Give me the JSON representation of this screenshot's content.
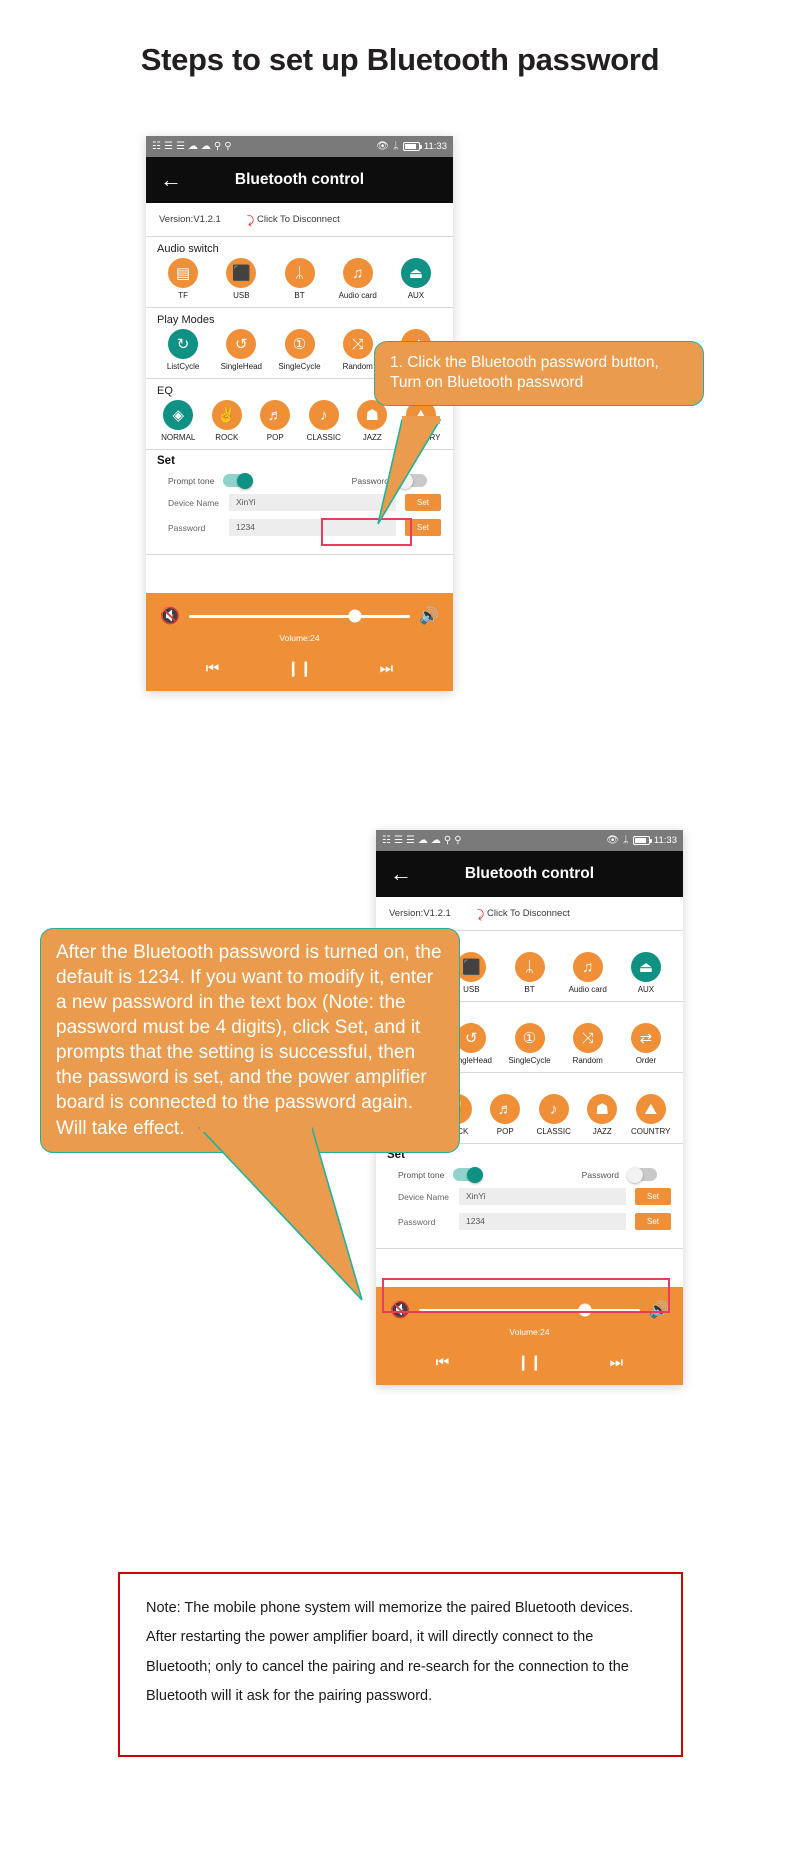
{
  "page": {
    "title": "Steps to set up Bluetooth password"
  },
  "colors": {
    "accent_orange": "#ef9039",
    "active_teal": "#0f9183",
    "callout_bg": "#eb9b4e",
    "callout_border": "#1fb39b",
    "highlight_red": "#ec3b5e",
    "note_border": "#cc0000",
    "appbar_black": "#0d0d0d",
    "statusbar_gray": "#7a7a7a"
  },
  "phone": {
    "statusbar": {
      "time": "11:33",
      "left_icons": [
        "sim-dual-icon",
        "signal-1-icon",
        "signal-2-icon",
        "wifi-icon",
        "cloud-icon",
        "person-1-icon",
        "person-2-icon"
      ],
      "right_icons": [
        "eye-icon",
        "bluetooth-icon",
        "battery-icon"
      ]
    },
    "appbar": {
      "back_label": "←",
      "title": "Bluetooth control"
    },
    "version_row": {
      "version": "Version:V1.2.1",
      "disconnect_label": "Click To Disconnect",
      "disconnect_icon": "broken-link-icon"
    },
    "audio_switch": {
      "heading": "Audio switch",
      "items": [
        {
          "label": "TF",
          "icon": "sd-card-icon",
          "glyph": "▤",
          "active": false
        },
        {
          "label": "USB",
          "icon": "usb-drive-icon",
          "glyph": "⬛",
          "active": false
        },
        {
          "label": "BT",
          "icon": "bluetooth-icon",
          "glyph": "ᛦ",
          "active": false
        },
        {
          "label": "Audio card",
          "icon": "music-note-icon",
          "glyph": "♫",
          "active": false
        },
        {
          "label": "AUX",
          "icon": "aux-cable-icon",
          "glyph": "⏏",
          "active": true
        }
      ]
    },
    "play_modes": {
      "heading": "Play Modes",
      "items": [
        {
          "label": "ListCycle",
          "icon": "repeat-icon",
          "glyph": "↻",
          "active": true
        },
        {
          "label": "SingleHead",
          "icon": "repeat-once-arrow-icon",
          "glyph": "↺",
          "active": false
        },
        {
          "label": "SingleCycle",
          "icon": "repeat-one-icon",
          "glyph": "①",
          "active": false
        },
        {
          "label": "Random",
          "icon": "shuffle-icon",
          "glyph": "⤨",
          "active": false
        },
        {
          "label": "Order",
          "icon": "order-arrows-icon",
          "glyph": "⇄",
          "active": false
        }
      ]
    },
    "eq": {
      "heading": "EQ",
      "items": [
        {
          "label": "NORMAL",
          "icon": "target-diamond-icon",
          "glyph": "◈",
          "active": true
        },
        {
          "label": "ROCK",
          "icon": "rock-hand-icon",
          "glyph": "✌",
          "active": false
        },
        {
          "label": "POP",
          "icon": "headphones-icon",
          "glyph": "♬",
          "active": false
        },
        {
          "label": "CLASSIC",
          "icon": "vinyl-note-icon",
          "glyph": "♪",
          "active": false
        },
        {
          "label": "JAZZ",
          "icon": "hat-icon",
          "glyph": "☗",
          "active": false
        },
        {
          "label": "COUNTRY",
          "icon": "country-icon",
          "glyph": "⛰",
          "active": false
        }
      ]
    },
    "set": {
      "heading": "Set",
      "prompt_tone_label": "Prompt tone",
      "prompt_tone_on": true,
      "password_toggle_label": "Password",
      "password_toggle_on": false,
      "device_name_label": "Device Name",
      "device_name_value": "XinYi",
      "device_name_button": "Set",
      "password_label": "Password",
      "password_value": "1234",
      "password_button": "Set"
    },
    "player": {
      "mute_icon": "volume-mute-icon",
      "volume_icon": "volume-up-icon",
      "volume_label": "Volume:24",
      "volume_percent": 75,
      "prev_label": "⏮",
      "pause_label": "❙❙",
      "next_label": "⏭"
    }
  },
  "callouts": {
    "step1": "1. Click the Bluetooth password button, Turn on Bluetooth password",
    "step2": "After the Bluetooth password is turned on, the default is 1234. If you want to modify it, enter a new password in the text box (Note: the password must be 4 digits), click Set, and it prompts that the setting is successful, then the password is set, and the power amplifier board is connected to the password again. Will take effect."
  },
  "note": {
    "text": "Note: The mobile phone system will memorize the paired Bluetooth devices. After restarting the power amplifier board, it will directly connect to the Bluetooth; only to cancel the pairing and re-search for the connection to the Bluetooth will it ask for the pairing password."
  }
}
